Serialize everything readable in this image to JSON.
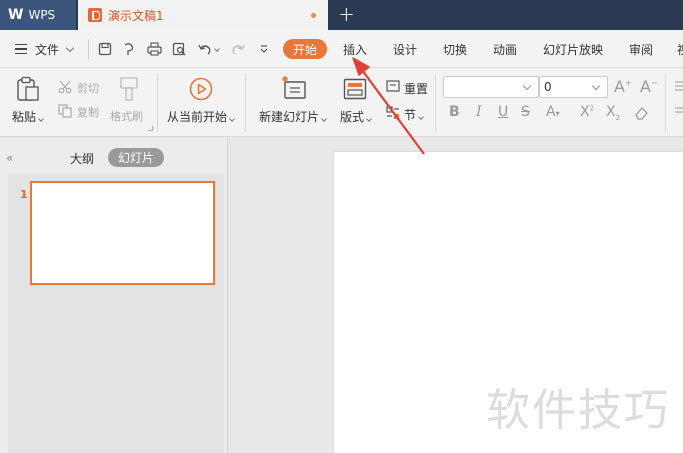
{
  "titlebar": {
    "app_name": "WPS",
    "doc_title": "演示文稿1",
    "new_tab": "+"
  },
  "menubar": {
    "file_label": "文件",
    "tabs": [
      "开始",
      "插入",
      "设计",
      "切换",
      "动画",
      "幻灯片放映",
      "审阅",
      "视"
    ]
  },
  "ribbon": {
    "paste": "粘贴",
    "cut": "剪切",
    "copy": "复制",
    "format_painter": "格式刷",
    "from_current": "从当前开始",
    "new_slide": "新建幻灯片",
    "layout": "版式",
    "reset": "重置",
    "section": "节",
    "font_size_value": "0"
  },
  "left_panel": {
    "outline_tab": "大纲",
    "slides_tab": "幻灯片",
    "slide_number": "1"
  },
  "watermark": "软件技巧",
  "colors": {
    "accent": "#e8773a",
    "titlebar": "#2b3a52",
    "arrow": "#e0413a"
  },
  "icons": [
    "wps-logo-icon",
    "document-icon",
    "menu-icon",
    "save-icon",
    "undo-icon",
    "redo-icon",
    "print-icon",
    "preview-icon",
    "play-icon",
    "new-slide-icon",
    "layout-icon",
    "reset-icon",
    "section-icon",
    "bold-icon",
    "italic-icon",
    "underline-icon",
    "strikethrough-icon",
    "superscript-icon",
    "subscript-icon",
    "eraser-icon",
    "font-grow-icon",
    "font-shrink-icon"
  ]
}
